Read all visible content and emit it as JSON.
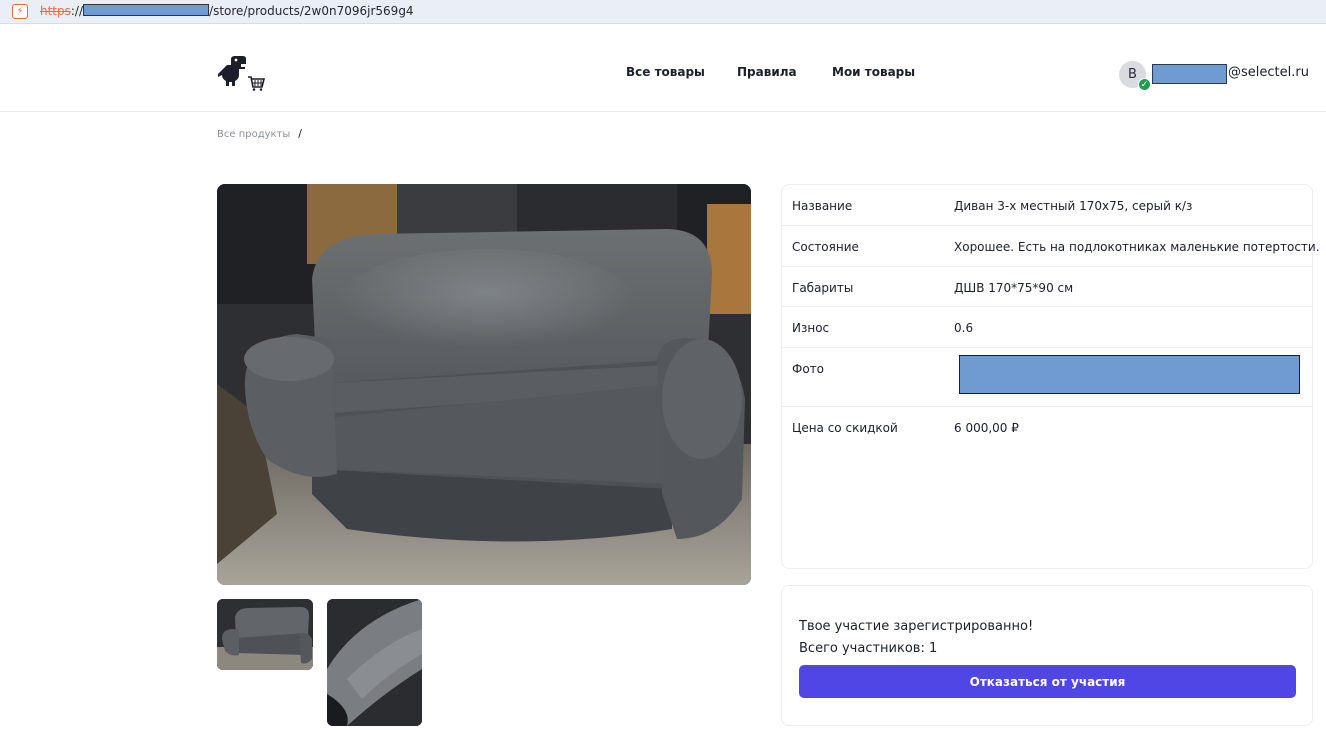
{
  "browser": {
    "url_scheme": "https",
    "url_separator": "://",
    "url_path": "/store/products/2w0n7096jr569g4"
  },
  "header": {
    "nav": {
      "all_products": "Все товары",
      "rules": "Правила",
      "my_products": "Мои товары"
    },
    "user": {
      "avatar_letter": "B",
      "email_suffix": "@selectel.ru"
    }
  },
  "breadcrumb": {
    "root": "Все продукты",
    "separator": "/"
  },
  "product": {
    "rows": [
      {
        "label": "Название",
        "value": "Диван 3-х местный 170х75, серый к/з"
      },
      {
        "label": "Состояние",
        "value": "Хорошее. Есть на подлокотниках маленькие потертости."
      },
      {
        "label": "Габариты",
        "value": "ДШВ 170*75*90 см"
      },
      {
        "label": "Износ",
        "value": "0.6"
      },
      {
        "label": "Фото",
        "value": ""
      },
      {
        "label": "Цена со скидкой",
        "value": "6 000,00 ₽"
      }
    ]
  },
  "participation": {
    "message": "Твое участие зарегистрированно!",
    "count_text": "Всего участников: 1",
    "cancel_label": "Отказаться от участия"
  },
  "colors": {
    "accent": "#4f46e5",
    "redaction": "#6f9bd0",
    "success": "#1f9d4d"
  }
}
